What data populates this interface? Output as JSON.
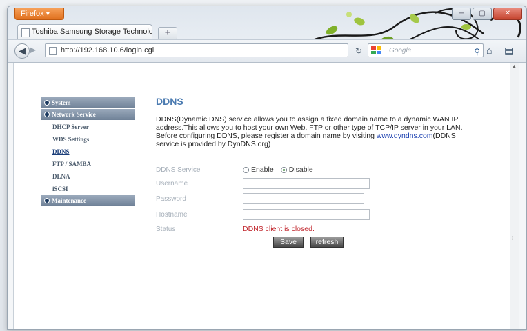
{
  "browser": {
    "menu_button": "Firefox",
    "tab_title": "Toshiba Samsung Storage Technology",
    "new_tab": "+",
    "url": "http://192.168.10.6/login.cgi",
    "search_placeholder": "Google"
  },
  "sidebar": {
    "sections": [
      {
        "label": "System"
      },
      {
        "label": "Network Service"
      },
      {
        "label": "Maintenance"
      }
    ],
    "items": [
      "DHCP Server",
      "WDS Settings",
      "DDNS",
      "FTP / SAMBA",
      "DLNA",
      "iSCSI"
    ]
  },
  "page": {
    "title": "DDNS",
    "description_1": "DDNS(Dynamic DNS) service allows you to assign a fixed domain name to a dynamic WAN IP address.This allows you to host your own Web, FTP or other type of TCP/IP server in your LAN. Before configuring DDNS, please register a domain name by visiting ",
    "link": "www.dyndns.com",
    "description_2": "(DDNS service is provided by DynDNS.org)",
    "form": {
      "service_label": "DDNS Service",
      "enable_label": "Enable",
      "disable_label": "Disable",
      "selected": "Disable",
      "username_label": "Username",
      "username_value": "",
      "password_label": "Password",
      "password_value": "",
      "hostname_label": "Hostname",
      "hostname_value": "",
      "status_label": "Status",
      "status_value": "DDNS client is closed."
    },
    "buttons": {
      "save": "Save",
      "refresh": "refresh"
    }
  }
}
